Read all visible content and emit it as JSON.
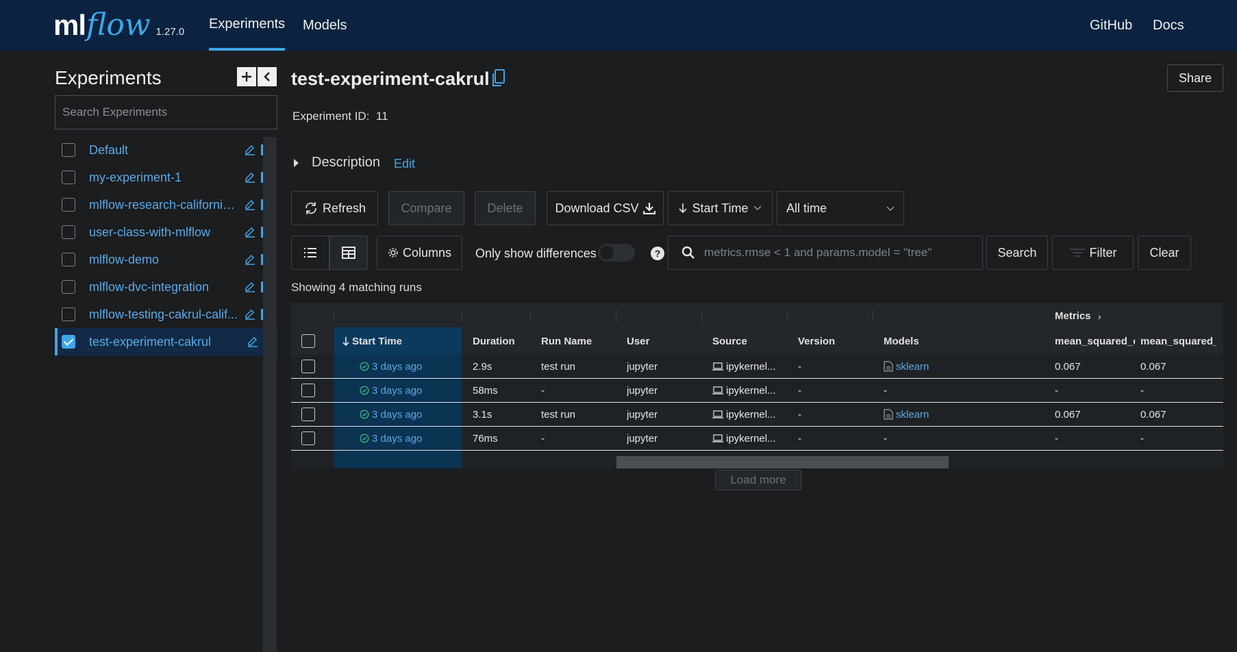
{
  "header": {
    "logo_ml": "ml",
    "logo_flow": "flow",
    "version": "1.27.0",
    "nav": {
      "experiments": "Experiments",
      "models": "Models",
      "github": "GitHub",
      "docs": "Docs"
    }
  },
  "sidebar": {
    "title": "Experiments",
    "add_icon": "plus-icon",
    "collapse_icon": "chevron-left-icon",
    "search_placeholder": "Search Experiments",
    "items": [
      {
        "label": "Default",
        "checked": false
      },
      {
        "label": "my-experiment-1",
        "checked": false
      },
      {
        "label": "mlflow-research-california-...",
        "checked": false
      },
      {
        "label": "user-class-with-mlflow",
        "checked": false
      },
      {
        "label": "mlflow-demo",
        "checked": false
      },
      {
        "label": "mlflow-dvc-integration",
        "checked": false
      },
      {
        "label": "mlflow-testing-cakrul-calif...",
        "checked": false
      },
      {
        "label": "test-experiment-cakrul",
        "checked": true
      }
    ]
  },
  "main": {
    "title": "test-experiment-cakrul",
    "share": "Share",
    "experiment_id_label": "Experiment ID:",
    "experiment_id": "11",
    "description_label": "Description",
    "description_edit": "Edit",
    "toolbar": {
      "refresh": "Refresh",
      "compare": "Compare",
      "delete": "Delete",
      "download_csv": "Download CSV",
      "sort": "Start Time",
      "time_range": "All time",
      "columns": "Columns",
      "only_diff": "Only show differences",
      "search_placeholder": "metrics.rmse < 1 and params.model = \"tree\"",
      "search": "Search",
      "filter": "Filter",
      "clear": "Clear"
    },
    "showing": "Showing 4 matching runs",
    "table": {
      "group_metrics": "Metrics",
      "columns": [
        "Start Time",
        "Duration",
        "Run Name",
        "User",
        "Source",
        "Version",
        "Models",
        "mean_squared_e",
        "mean_squared_e"
      ],
      "rows": [
        {
          "start": "3 days ago",
          "duration": "2.9s",
          "run_name": "test run",
          "user": "jupyter",
          "source": "ipykernel...",
          "version": "-",
          "model": "sklearn",
          "m1": "0.067",
          "m2": "0.067"
        },
        {
          "start": "3 days ago",
          "duration": "58ms",
          "run_name": "-",
          "user": "jupyter",
          "source": "ipykernel...",
          "version": "-",
          "model": "-",
          "m1": "-",
          "m2": "-"
        },
        {
          "start": "3 days ago",
          "duration": "3.1s",
          "run_name": "test run",
          "user": "jupyter",
          "source": "ipykernel...",
          "version": "-",
          "model": "sklearn",
          "m1": "0.067",
          "m2": "0.067"
        },
        {
          "start": "3 days ago",
          "duration": "76ms",
          "run_name": "-",
          "user": "jupyter",
          "source": "ipykernel...",
          "version": "-",
          "model": "-",
          "m1": "-",
          "m2": "-"
        }
      ]
    },
    "load_more": "Load more"
  },
  "colors": {
    "header_bg": "#0b2340",
    "accent": "#3fa6e8",
    "link": "#5aa9e6",
    "success": "#3ab27d",
    "background": "#1b1d1f"
  }
}
